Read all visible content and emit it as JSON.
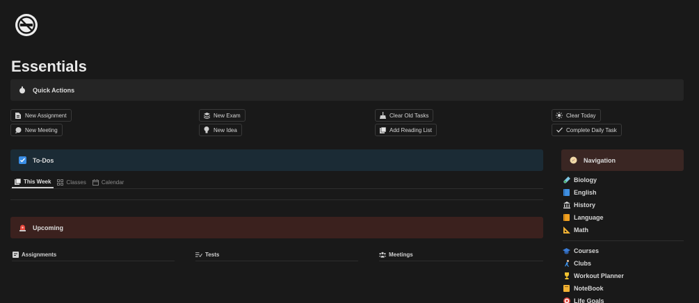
{
  "page": {
    "title": "Essentials",
    "icon": "no-smoking-icon"
  },
  "quick_actions": {
    "heading": "Quick Actions",
    "icon": "stopwatch-icon",
    "buttons": [
      {
        "label": "New Assignment",
        "icon": "document-icon"
      },
      {
        "label": "New Meeting",
        "icon": "chat-bubble-icon"
      },
      {
        "label": "New Exam",
        "icon": "stack-icon"
      },
      {
        "label": "New Idea",
        "icon": "lightbulb-icon"
      },
      {
        "label": "Clear Old Tasks",
        "icon": "broom-icon"
      },
      {
        "label": "Add Reading List",
        "icon": "book-icon"
      },
      {
        "label": "Clear Today",
        "icon": "sun-icon"
      },
      {
        "label": "Complete Daily Task",
        "icon": "checkmark-icon"
      }
    ]
  },
  "todos": {
    "heading": "To-Dos",
    "icon": "checkbox-icon",
    "tabs": [
      {
        "label": "This Week",
        "icon": "book-icon",
        "active": true
      },
      {
        "label": "Classes",
        "icon": "grid-icon",
        "active": false
      },
      {
        "label": "Calendar",
        "icon": "calendar-icon",
        "active": false
      }
    ]
  },
  "upcoming": {
    "heading": "Upcoming",
    "icon": "siren-icon",
    "columns": [
      {
        "label": "Assignments",
        "icon": "notepad-icon"
      },
      {
        "label": "Tests",
        "icon": "list-check-icon"
      },
      {
        "label": "Meetings",
        "icon": "people-icon"
      }
    ]
  },
  "navigation": {
    "heading": "Navigation",
    "icon": "compass-icon",
    "subjects": [
      {
        "label": "Biology",
        "icon": "test-tube-icon"
      },
      {
        "label": "English",
        "icon": "blue-book-icon"
      },
      {
        "label": "History",
        "icon": "museum-icon"
      },
      {
        "label": "Language",
        "icon": "orange-book-icon"
      },
      {
        "label": "Math",
        "icon": "triangle-ruler-icon"
      }
    ],
    "links": [
      {
        "label": "Courses",
        "icon": "graduation-cap-icon"
      },
      {
        "label": "Clubs",
        "icon": "runner-icon"
      },
      {
        "label": "Workout Planner",
        "icon": "trophy-icon"
      },
      {
        "label": "NoteBook",
        "icon": "notebook-icon"
      },
      {
        "label": "Life Goals",
        "icon": "target-icon"
      }
    ]
  },
  "colors": {
    "background": "#191919",
    "quick_actions_bg": "#252525",
    "todos_bg": "#1b2b35",
    "upcoming_bg": "#3b211e",
    "navigation_bg": "#3a2623"
  }
}
